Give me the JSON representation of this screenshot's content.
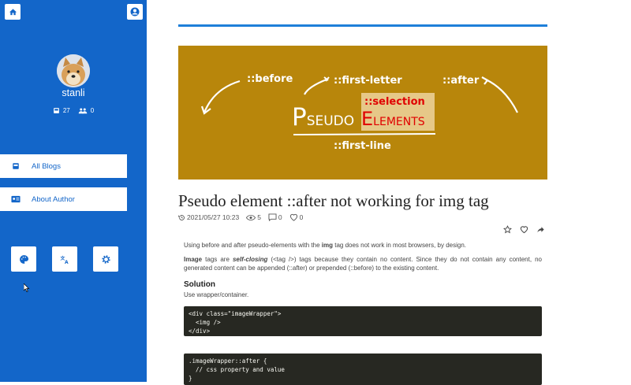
{
  "sidebar": {
    "username": "stanli",
    "stats": {
      "blogs": "27",
      "followers": "0"
    },
    "nav": [
      {
        "label": "All Blogs"
      },
      {
        "label": "About Author"
      }
    ]
  },
  "banner": {
    "before": "::before",
    "first_letter": "::first-letter",
    "after": "::after",
    "selection": "::selection",
    "first_line": "::first-line",
    "pseudo_P": "P",
    "pseudo_rest": "SEUDO",
    "elements_E": "E",
    "elements_rest": "LEMENTS"
  },
  "post": {
    "title": "Pseudo element ::after not working for img tag",
    "date": "2021/05/27 10:23",
    "views": "5",
    "comments": "0",
    "likes": "0",
    "intro_pre": "Using before and after pseudo-elements with the ",
    "intro_bold": "img",
    "intro_post": " tag does not work in most browsers, by design.",
    "p2_bold": "Image",
    "p2_mid": " tags are ",
    "p2_em": "self-closing",
    "p2_rest": " (<tag />) tags because they contain no content. Since they do not contain any content, no generated content can be appended (::after) or prepended (::before) to the existing content.",
    "solution_heading": "Solution",
    "solution_text": "Use wrapper/container.",
    "code1": "<div class=\"imageWrapper\">\n  <img />\n</div>",
    "code2": ".imageWrapper::after {\n  // css property and value\n}"
  },
  "colors": {
    "sidebar": "#1366c9",
    "banner": "#b8860b",
    "accent": "#1e7fd9"
  }
}
